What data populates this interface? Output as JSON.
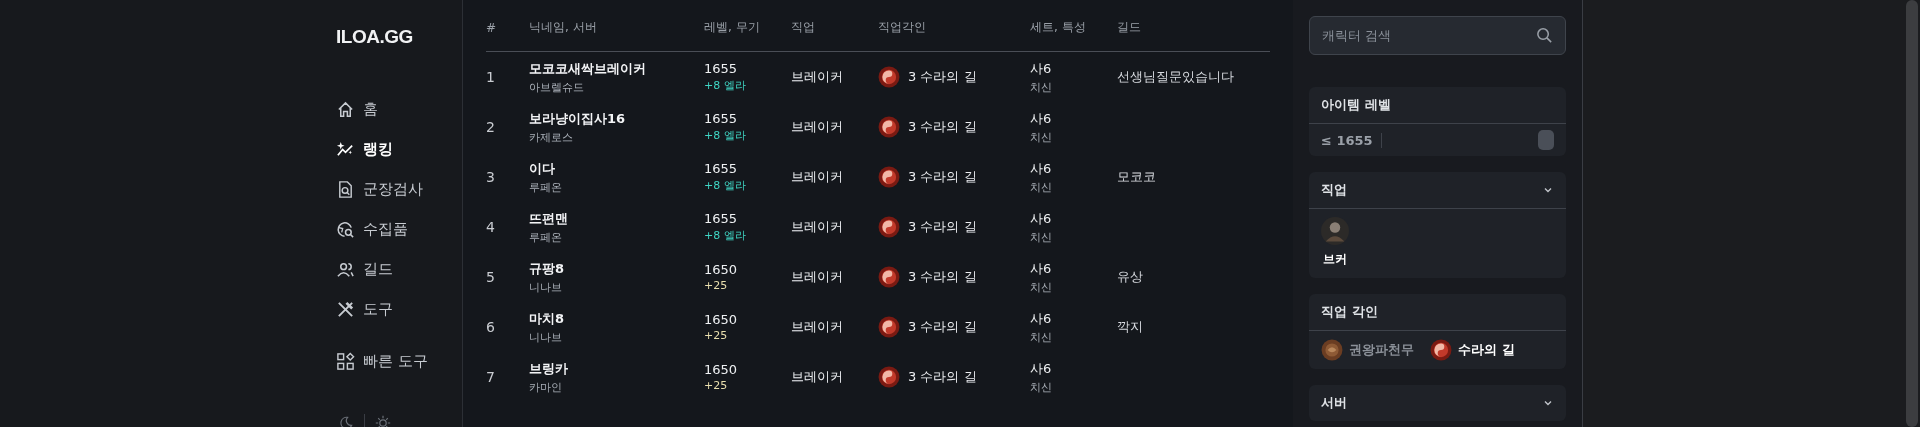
{
  "logo": "ILOA.GG",
  "nav": [
    {
      "label": "홈",
      "selected": false
    },
    {
      "label": "랭킹",
      "selected": true
    },
    {
      "label": "군장검사",
      "selected": false
    },
    {
      "label": "수집품",
      "selected": false
    },
    {
      "label": "길드",
      "selected": false
    },
    {
      "label": "도구",
      "selected": false
    },
    {
      "label": "빠른 도구",
      "selected": false
    }
  ],
  "table": {
    "columns": [
      "#",
      "닉네임, 서버",
      "레벨, 무기",
      "직업",
      "직업각인",
      "세트, 특성",
      "길드"
    ],
    "rows": [
      {
        "rank": "1",
        "name": "모코코새싹브레이커",
        "server": "아브렐슈드",
        "level": "1655",
        "weapon": "+8 엘라",
        "color": "#3fd6c4",
        "class": "브레이커",
        "engraving": "3 수라의 길",
        "set": "사6",
        "trait": "치신",
        "guild": "선생님질문있습니다"
      },
      {
        "rank": "2",
        "name": "보라냥이집사16",
        "server": "카제로스",
        "level": "1655",
        "weapon": "+8 엘라",
        "color": "#3fd6c4",
        "class": "브레이커",
        "engraving": "3 수라의 길",
        "set": "사6",
        "trait": "치신"
      },
      {
        "rank": "3",
        "name": "이다",
        "server": "루페온",
        "level": "1655",
        "weapon": "+8 엘라",
        "color": "#3fd6c4",
        "class": "브레이커",
        "engraving": "3 수라의 길",
        "set": "사6",
        "trait": "치신",
        "guild": "모코코"
      },
      {
        "rank": "4",
        "name": "뜨편맨",
        "server": "루페온",
        "level": "1655",
        "weapon": "+8 엘라",
        "color": "#3fd6c4",
        "class": "브레이커",
        "engraving": "3 수라의 길",
        "set": "사6",
        "trait": "치신"
      },
      {
        "rank": "5",
        "name": "규팡8",
        "server": "니나브",
        "level": "1650",
        "weapon": "+25",
        "color": "#e9dfae",
        "class": "브레이커",
        "engraving": "3 수라의 길",
        "set": "사6",
        "trait": "치신",
        "guild": "유상"
      },
      {
        "rank": "6",
        "name": "마치8",
        "server": "니나브",
        "level": "1650",
        "weapon": "+25",
        "color": "#e9dfae",
        "class": "브레이커",
        "engraving": "3 수라의 길",
        "set": "사6",
        "trait": "치신",
        "guild": "깍지"
      },
      {
        "rank": "7",
        "name": "브링카",
        "server": "카마인",
        "level": "1650",
        "weapon": "+25",
        "color": "#e9dfae",
        "class": "브레이커",
        "engraving": "3 수라의 길",
        "set": "사6",
        "trait": "치신"
      }
    ]
  },
  "search": {
    "placeholder": "캐릭터 검색"
  },
  "filters": {
    "item_level": {
      "title": "아이템 레벨",
      "reading": "≤ 1655",
      "level": 1
    },
    "class": {
      "title": "직업",
      "expanded": true,
      "options": [
        {
          "label": "브커",
          "selected": true
        }
      ]
    },
    "engraving": {
      "title": "직업 각인",
      "options": [
        {
          "label": "권왕파천무",
          "selected": false
        },
        {
          "label": "수라의 길",
          "selected": true
        }
      ]
    },
    "server": {
      "title": "서버",
      "expanded": false
    }
  }
}
